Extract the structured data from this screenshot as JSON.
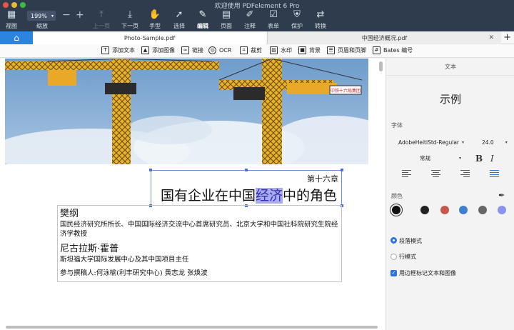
{
  "window": {
    "title": "欢迎使用 PDFelement 6 Pro"
  },
  "toolbar": {
    "view": "视图",
    "zoom_value": "199%",
    "zoom": "缩放",
    "prev": "上一页",
    "next": "下一页",
    "hand": "手型",
    "select": "选择",
    "edit": "编辑",
    "page": "页面",
    "comment": "注释",
    "form": "表单",
    "protect": "保护",
    "convert": "转换"
  },
  "tabs": {
    "doc1": "Photo-Sample.pdf",
    "doc2": "中国经济概况.pdf"
  },
  "edit_tools": {
    "add_text": "添加文本",
    "add_image": "添加图像",
    "link": "链接",
    "ocr": "OCR",
    "crop": "裁剪",
    "watermark": "水印",
    "background": "背景",
    "header_footer": "页眉和页脚",
    "bates": "Bates 编号"
  },
  "document": {
    "chapter": "第十六章",
    "title_pre": "国有企业在中国",
    "title_highlight": "经济",
    "title_post": "中的角色",
    "crane_sign": "中铁十六局集团",
    "author1_name": "樊纲",
    "author1_desc": "国民经济研究所所长、中国国际经济交流中心首席研究员、北京大学和中国社科院研究生院经济学教授",
    "author2_name": "尼古拉斯·霍普",
    "author2_desc": "斯坦福大学国际发展中心及其中国项目主任",
    "contributors": "参与撰稿人:何泳榆(利丰研究中心) 黄志龙 张焕波"
  },
  "panel": {
    "header": "文本",
    "example": "示例",
    "font_label": "字体",
    "font_name": "AdobeHeitiStd-Regular",
    "font_size": "24.0",
    "font_style": "常规",
    "bold": "B",
    "italic": "I",
    "color_label": "颜色",
    "colors": [
      "#111111",
      "#222222",
      "#c8584a",
      "#3f7fd0",
      "#666666",
      "#8a94f0"
    ],
    "mode_paragraph": "段落模式",
    "mode_line": "行模式",
    "mode_paragraph_selected": true,
    "edit_with_border": "用边框标记文本和图像",
    "edit_with_border_checked": true
  },
  "colors": {
    "accent": "#2a84e0",
    "toolbar_bg": "#2f3c4e",
    "highlight": "#a7adf0"
  }
}
